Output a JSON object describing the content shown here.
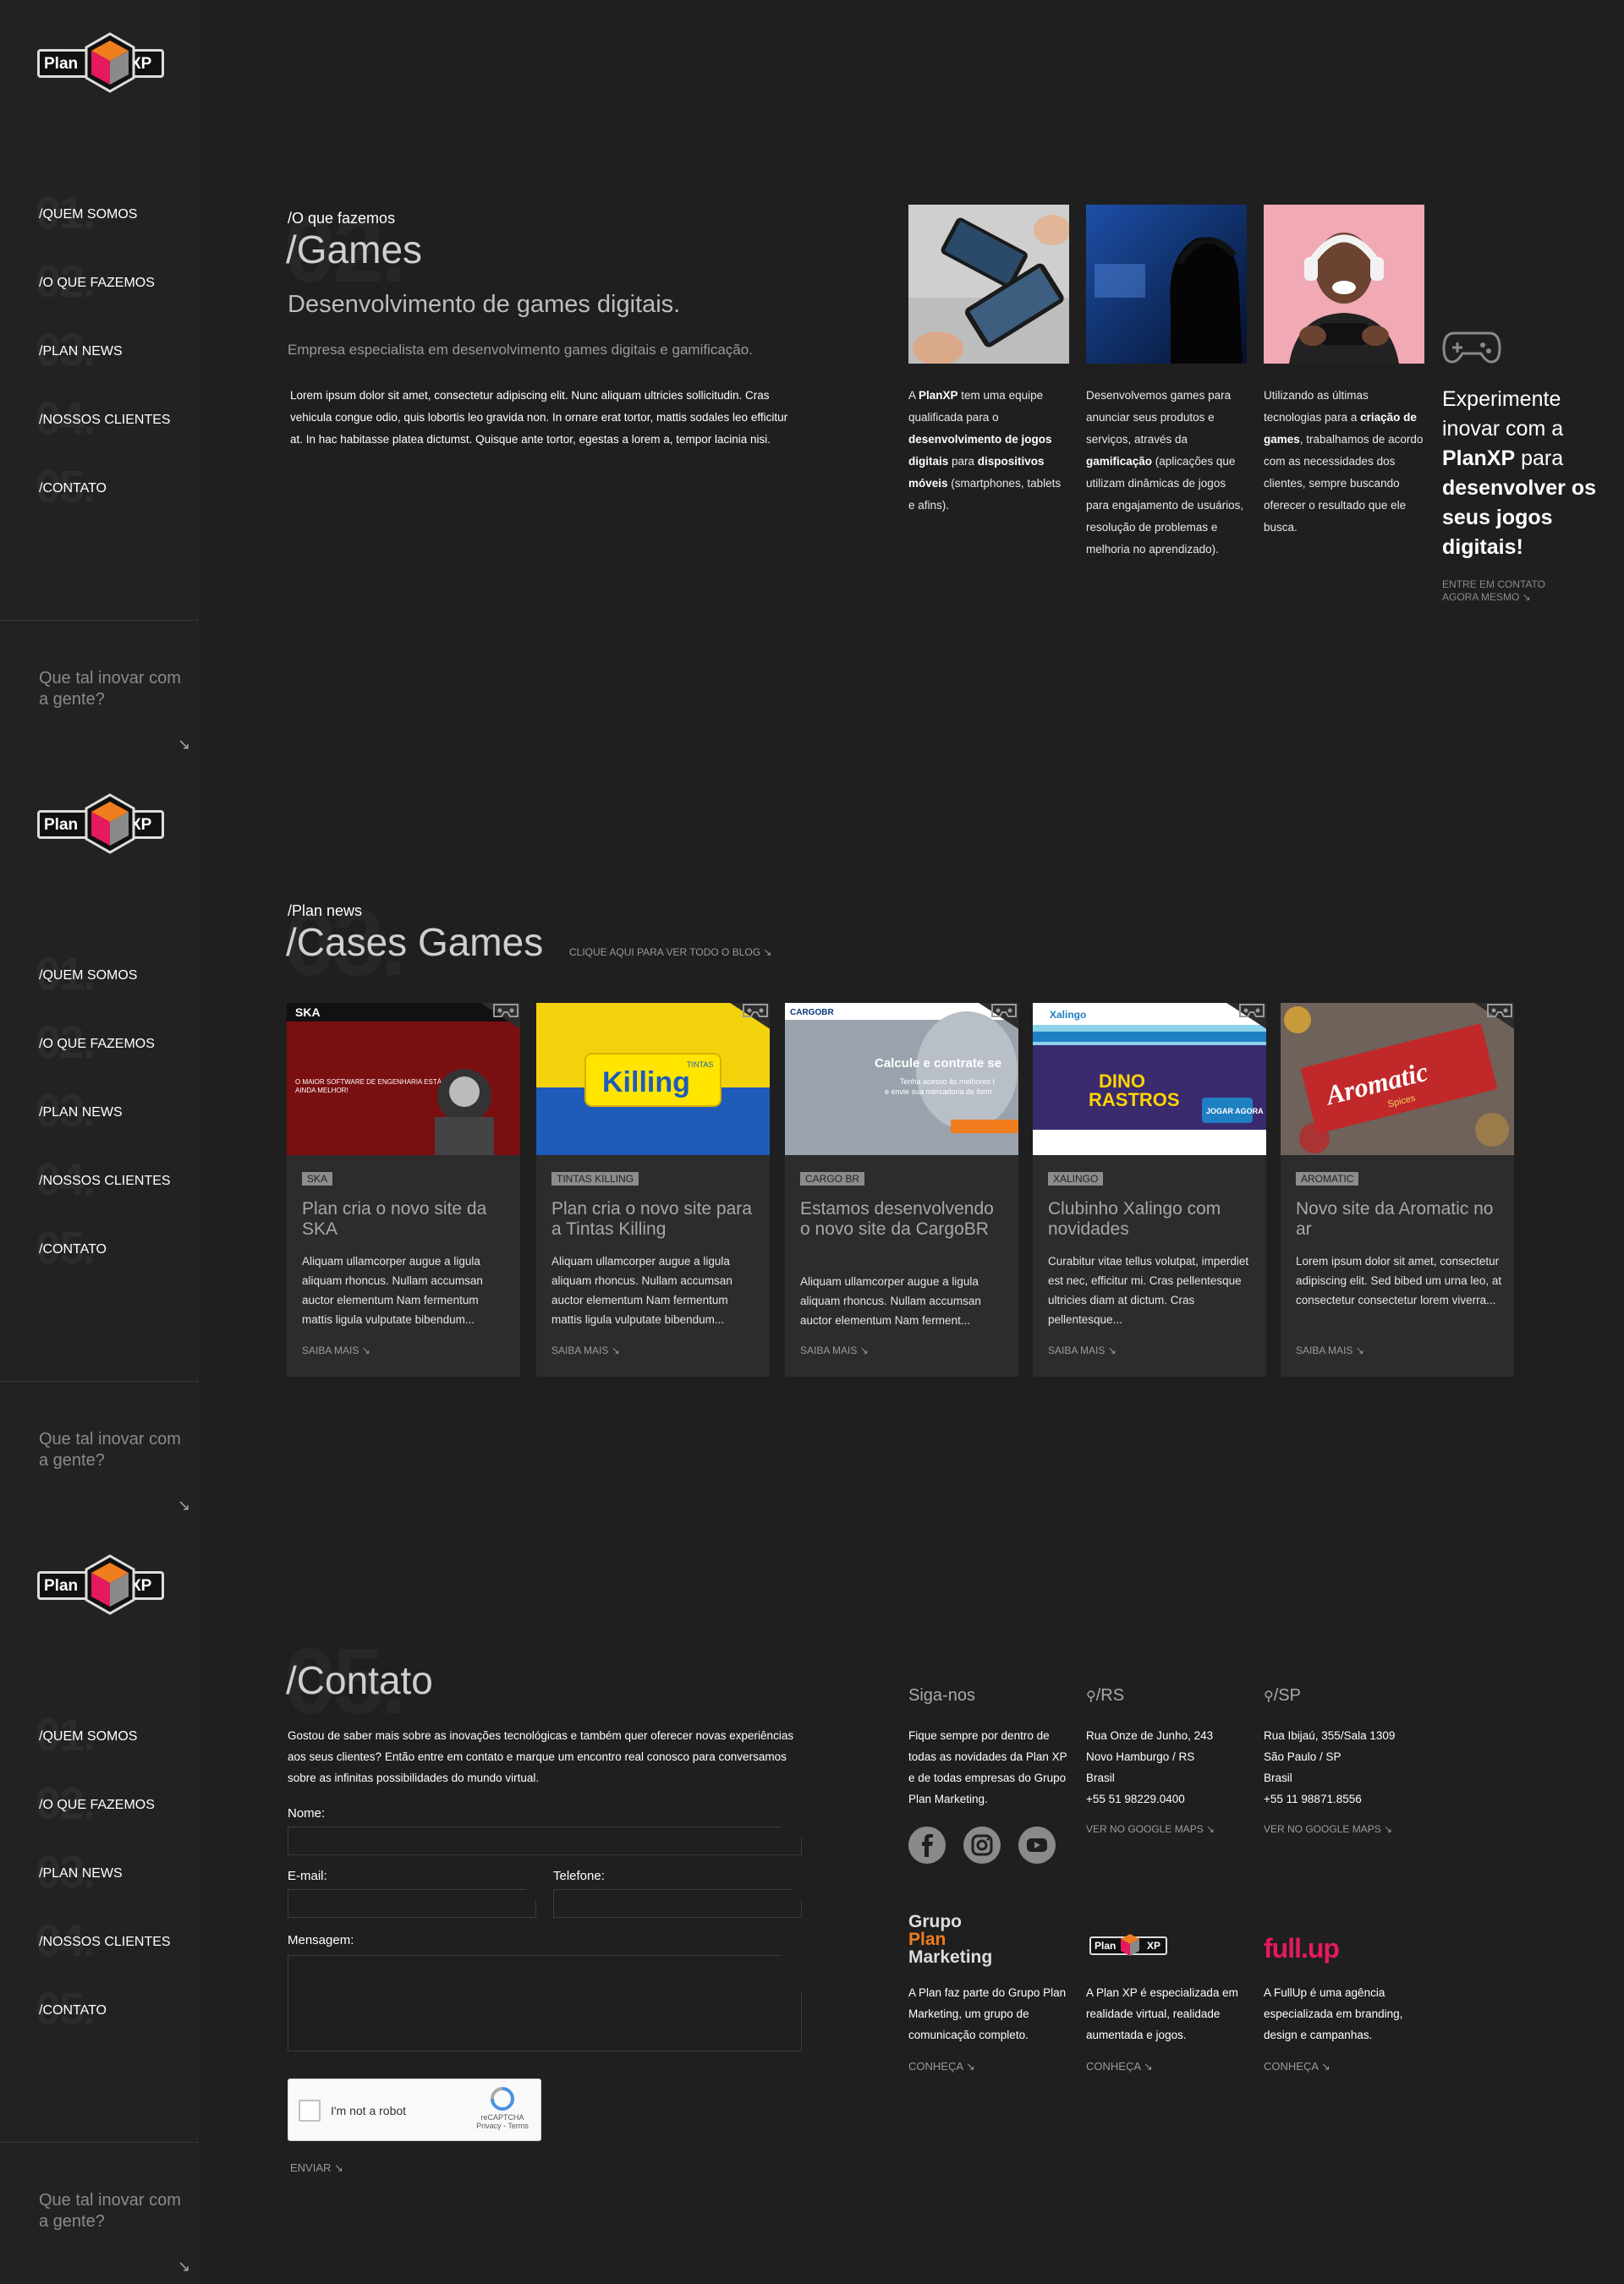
{
  "brand": {
    "plan": "Plan",
    "xp": "XP"
  },
  "nav": [
    {
      "num": "01.",
      "label": "/QUEM SOMOS"
    },
    {
      "num": "02.",
      "label": "/O QUE FAZEMOS"
    },
    {
      "num": "03.",
      "label": "/PLAN NEWS"
    },
    {
      "num": "04.",
      "label": "/NOSSOS CLIENTES"
    },
    {
      "num": "05.",
      "label": "/CONTATO"
    }
  ],
  "sidebar_cta": {
    "ghost": "?",
    "text": "Que tal inovar com a gente?",
    "arrow": "↘"
  },
  "games": {
    "sub": "/O que fazemos",
    "ghost": "02.",
    "title": "/Games",
    "lead": "Desenvolvimento de games digitais.",
    "subline": "Empresa especialista em desenvolvimento games digitais e gamificação.",
    "body": "Lorem ipsum dolor sit amet, consectetur adipiscing elit. Nunc aliquam ultricies sollicitudin. Cras vehicula congue odio, quis lobortis leo gravida non. In ornare erat tortor, mattis sodales leo efficitur at. In hac habitasse platea dictumst. Quisque ante tortor, egestas a lorem a, tempor lacinia nisi.",
    "col1": {
      "a": "A ",
      "b1": "PlanXP",
      "c": " tem uma equipe qualificada para o ",
      "b2": "desenvolvimento de jogos digitais",
      "d": " para ",
      "b3": "dispositivos móveis",
      "e": " (smartphones, tablets e afins)."
    },
    "col2": {
      "a": "Desenvolvemos games para anunciar seus produtos e serviços, através da ",
      "b1": "gamificação",
      "c": " (aplicações que utilizam dinâmicas de jogos para engajamento de usuários, resolução de problemas e melhoria no aprendizado)."
    },
    "col3": {
      "a": "Utilizando as últimas tecnologias para a ",
      "b1": "criação de games",
      "c": ", trabalhamos de acordo com as necessidades dos clientes, sempre buscando oferecer o resultado que ele busca."
    },
    "cta": {
      "a": "Experimente inovar com a ",
      "b1": "PlanXP",
      "c": " para ",
      "b2": "desenvolver os seus jogos digitais!"
    },
    "cta_link": "ENTRE EM CONTATO AGORA MESMO ↘"
  },
  "news": {
    "sub": "/Plan news",
    "ghost": "03.",
    "title": "/Cases Games",
    "blog_link": "CLIQUE AQUI PARA VER TODO O BLOG ↘",
    "cards": [
      {
        "tag": "SKA",
        "title": "Plan cria o novo site da SKA",
        "body": "Aliquam ullamcorper augue a ligula aliquam rhoncus. Nullam accumsan auctor elementum Nam fermentum mattis ligula vulputate bibendum...",
        "more": "SAIBA MAIS ↘",
        "thumb_text": "SKA",
        "thumb_sub": "O MAIOR SOFTWARE DE ENGENHARIA ESTÁ AINDA MELHOR!"
      },
      {
        "tag": "TINTAS KILLING",
        "title": "Plan cria o novo site para a Tintas Killing",
        "body": "Aliquam ullamcorper augue a ligula aliquam rhoncus. Nullam accumsan auctor elementum Nam fermentum mattis ligula vulputate bibendum...",
        "more": "SAIBA MAIS ↘",
        "thumb_text": "Killing",
        "thumb_sub": "TINTAS"
      },
      {
        "tag": "CARGO BR",
        "title": "Estamos desenvolvendo o novo site da CargoBR",
        "body": "Aliquam ullamcorper augue a ligula aliquam rhoncus. Nullam accumsan auctor elementum Nam ferment...",
        "more": "SAIBA MAIS ↘",
        "thumb_text": "Calcule e contrate se",
        "thumb_sub": "Tenha acesso às melhores t e envie sua mercadoria de form"
      },
      {
        "tag": "XALINGO",
        "title": "Clubinho Xalingo com novidades",
        "body": "Curabitur vitae tellus volutpat, imperdiet est nec, efficitur mi. Cras pellentesque ultricies diam at dictum. Cras pellentesque...",
        "more": "SAIBA MAIS ↘",
        "thumb_text": "DINO RASTROS",
        "thumb_sub": "JOGAR AGORA"
      },
      {
        "tag": "AROMATIC",
        "title": "Novo site da Aromatic no ar",
        "body": "Lorem ipsum dolor sit amet, consectetur adipiscing elit. Sed bibed um urna leo, at consectetur consectetur  lorem viverra...",
        "more": "SAIBA MAIS ↘",
        "thumb_text": "Aromatic",
        "thumb_sub": "Spices"
      }
    ]
  },
  "contact": {
    "ghost": "05.",
    "title": "/Contato",
    "intro": "Gostou de saber mais sobre as inovações tecnológicas e também quer oferecer novas experiências aos seus clientes? Então entre em contato e marque um encontro real conosco para conversamos sobre as infinitas possibilidades do mundo virtual.",
    "name_label": "Nome:",
    "email_label": "E-mail:",
    "phone_label": "Telefone:",
    "message_label": "Mensagem:",
    "captcha": "I'm not a robot",
    "captcha_brand": "reCAPTCHA",
    "captcha_links": "Privacy - Terms",
    "send": "ENVIAR ↘"
  },
  "follow": {
    "head": "Siga-nos",
    "text": "Fique sempre por dentro de todas as novidades da Plan XP e de todas empresas do Grupo Plan Marketing."
  },
  "rs": {
    "head": "/RS",
    "l1": "Rua Onze de Junho, 243",
    "l2": "Novo Hamburgo / RS",
    "l3": "Brasil",
    "l4": "+55 51 98229.0400",
    "link": "VER NO GOOGLE MAPS ↘"
  },
  "sp": {
    "head": "/SP",
    "l1": "Rua Ibijaú, 355/Sala 1309",
    "l2": "São Paulo / SP",
    "l3": "Brasil",
    "l4": "+55 11 98871.8556",
    "link": "VER NO GOOGLE MAPS ↘"
  },
  "group": [
    {
      "logo1": "Grupo",
      "logo2": "Plan",
      "logo3": "Marketing",
      "text": "A Plan faz parte do Grupo Plan Marketing, um grupo de comunicação completo.",
      "link": "CONHEÇA ↘"
    },
    {
      "text": "A Plan XP é especializada em realidade virtual, realidade aumentada e jogos.",
      "link": "CONHEÇA ↘"
    },
    {
      "logo1": "full.up",
      "text": "A FullUp é uma agência especializada em branding, design e campanhas.",
      "link": "CONHEÇA ↘"
    }
  ],
  "colors": {
    "bg": "#1f1f1f",
    "accent_orange": "#f07d1e",
    "accent_pink": "#e5195e"
  }
}
